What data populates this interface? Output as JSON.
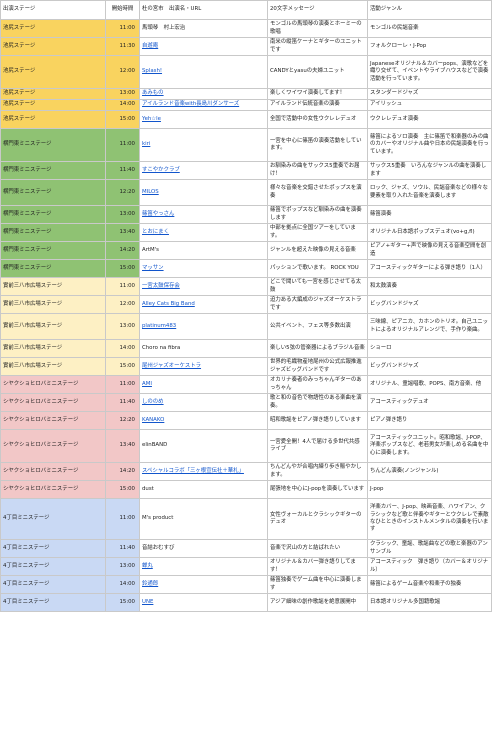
{
  "header": {
    "stage": "出演ステージ",
    "time": "開始時間",
    "name": "杜の宮市　出演名・URL",
    "msg": "20文字メッセージ",
    "genre": "活動ジャンル"
  },
  "stage_colors": {
    "yellow": "#f9d35f",
    "green": "#8fc273",
    "cream": "#fdf0c4",
    "pink": "#f2c7c7",
    "blue": "#c9d9f4"
  },
  "rows": [
    {
      "stage": "池尻ステージ",
      "color": "yellow",
      "time": "11:00",
      "name": "馬頭琴　村上宏治",
      "link": false,
      "msg": "モンゴルの馬頭琴の演奏とホーミーの歌唱",
      "genre": "モンゴルの民謡音楽",
      "h": 18
    },
    {
      "stage": "池尻ステージ",
      "color": "yellow",
      "time": "11:30",
      "name": "自遊庵",
      "link": true,
      "msg": "南米の縦笛ケーナとギターのユニットです",
      "genre": "フォルクローレ・J-Pop",
      "h": 18
    },
    {
      "stage": "池尻ステージ",
      "color": "yellow",
      "time": "12:00",
      "name": "Splash!",
      "link": true,
      "msg": "CANDYとyasuの夫婦ユニット",
      "genre": "Japaneseオリジナル＆カバーpops、演歌などを織り交ぜて、イベントやライブハウスなどで演奏活動を行っています。",
      "h": 33
    },
    {
      "stage": "池尻ステージ",
      "color": "yellow",
      "time": "13:00",
      "name": "あみもの",
      "link": true,
      "msg": "楽しくワイワイ演奏してます！",
      "genre": "スタンダードジャズ",
      "h": 11
    },
    {
      "stage": "池尻ステージ",
      "color": "yellow",
      "time": "14:00",
      "name": "アイルランド音楽with長島川ダンサーズ",
      "link": true,
      "msg": "アイルランド伝統音楽の演奏",
      "genre": "アイリッシュ",
      "h": 11
    },
    {
      "stage": "池尻ステージ",
      "color": "yellow",
      "time": "15:00",
      "name": "Yeh☆le",
      "link": true,
      "msg": "全国で活動中の女性ウクレレデュオ",
      "genre": "ウクレレデュオ演奏",
      "h": 18
    },
    {
      "stage": "横門東ミニステージ",
      "color": "green",
      "time": "11:00",
      "name": "kiri",
      "link": true,
      "msg": "一宮を中心に篠笛の演奏活動をしています。",
      "genre": "篠笛によるソロ演奏　主に篠笛で和楽器のみの曲のカバーやオリジナル曲や日本の民謡演奏を行っています。",
      "h": 33
    },
    {
      "stage": "横門東ミニステージ",
      "color": "green",
      "time": "11:40",
      "name": "すこやかクラブ",
      "link": true,
      "msg": "お馴染みの曲をサックス5重奏でお届け！",
      "genre": "サックス5重奏　いろんなジャンルの曲を演奏します",
      "h": 18
    },
    {
      "stage": "横門東ミニステージ",
      "color": "green",
      "time": "12:20",
      "name": "MILOS",
      "link": true,
      "msg": "様々な音楽を交錯させたポップスを演奏",
      "genre": "ロック、ジャズ、ソウル、民謡音楽などの様々な要素を取り入れた音楽を演奏します",
      "h": 26
    },
    {
      "stage": "横門東ミニステージ",
      "color": "green",
      "time": "13:00",
      "name": "篠笛やっさん",
      "link": true,
      "msg": "篠笛でポップスなど馴染みの曲を演奏します",
      "genre": "篠笛演奏",
      "h": 18
    },
    {
      "stage": "横門東ミニステージ",
      "color": "green",
      "time": "13:40",
      "name": "とおにまく",
      "link": true,
      "msg": "中部を拠点に全国ツアーをしています。",
      "genre": "オリジナル日本語ポップスデュオ(vo+g,fl)",
      "h": 18
    },
    {
      "stage": "横門東ミニステージ",
      "color": "green",
      "time": "14:20",
      "name": "ArtM's",
      "link": false,
      "msg": "ジャンルを超えた映像の見える音楽",
      "genre": "ピアノ+ギター+声で映像の見える音楽空間を創造",
      "h": 18
    },
    {
      "stage": "横門東ミニステージ",
      "color": "green",
      "time": "15:00",
      "name": "マッサン",
      "link": true,
      "msg": "パッションで歌います。 ROCK YOU",
      "genre": "アコースティックギターによる弾き語り（1人）",
      "h": 18
    },
    {
      "stage": "實前三八市広場ステージ",
      "color": "cream",
      "time": "11:00",
      "name": "一宮太鼓保存会",
      "link": true,
      "msg": "どこで聞いても一宮を感じさせてる太鼓",
      "genre": "和太鼓演奏",
      "h": 18
    },
    {
      "stage": "實前三八市広場ステージ",
      "color": "cream",
      "time": "12:00",
      "name": "Alley Cats Big Band",
      "link": true,
      "msg": "迫力ある大編成のジャズオーケストラです",
      "genre": "ビッグバンドジャズ",
      "h": 18
    },
    {
      "stage": "實前三八市広場ステージ",
      "color": "cream",
      "time": "13:00",
      "name": "platinum483",
      "link": true,
      "msg": "公共イベント、フェス等多数出演",
      "genre": "三味線、ピアニカ、カホンのトリオ。自己ユニットによるオリジナルアレンジで、手作り楽曲。",
      "h": 26
    },
    {
      "stage": "實前三八市広場ステージ",
      "color": "cream",
      "time": "14:00",
      "name": "Choro na fibra",
      "link": false,
      "msg": "楽しい5弦の管楽器によるブラジル音楽",
      "genre": "ショーロ",
      "h": 18
    },
    {
      "stage": "實前三八市広場ステージ",
      "color": "cream",
      "time": "15:00",
      "name": "尾州ジャズオーケストラ",
      "link": true,
      "msg": "世界的毛織物産地尾州の公式広報推進ジャズビッグバンドです",
      "genre": "ビッグバンドジャズ",
      "h": 18
    },
    {
      "stage": "シヤクショヒロバミニステージ",
      "color": "pink",
      "time": "11:00",
      "name": "AMI",
      "link": true,
      "msg": "オカリナ奏者のみっちゃんギターのあっちゃん",
      "genre": "オリジナル、童謡唱歌、POPS、南方音楽、他",
      "h": 18
    },
    {
      "stage": "シヤクショヒロバミニステージ",
      "color": "pink",
      "time": "11:40",
      "name": "しののめ",
      "link": true,
      "msg": "歌と和の音色で物語性のある楽曲を演奏。",
      "genre": "アコースティックデュオ",
      "h": 18
    },
    {
      "stage": "シヤクショヒロバミニステージ",
      "color": "pink",
      "time": "12:20",
      "name": "KANAKO",
      "link": true,
      "msg": "昭和歌謡をピアノ弾き語りしています",
      "genre": "ピアノ弾き語り",
      "h": 18
    },
    {
      "stage": "シヤクショヒロバミニステージ",
      "color": "pink",
      "time": "13:40",
      "name": "elinBAND",
      "link": false,
      "msg": "一宮愛全開！4人で届ける多世代共感ライブ",
      "genre": "アコースティックユニット。昭和歌謡、J-POP、洋楽ポップスなど、老若男女が楽しめる名曲を中心に演奏します。",
      "h": 33
    },
    {
      "stage": "シヤクショヒロバミニステージ",
      "color": "pink",
      "time": "14:20",
      "name": "スペシャルコラボ「三ヶ根宣伝社＋華札」",
      "link": true,
      "msg": "ちんどんやが合唱内練り歩き賑やかします。",
      "genre": "ちんどん演奏(ノンジャンル)",
      "h": 18
    },
    {
      "stage": "シヤクショヒロバミニステージ",
      "color": "pink",
      "time": "15:00",
      "name": "dust",
      "link": false,
      "msg": "尾張地を中心にJ-popを演奏しています",
      "genre": "J-pop",
      "h": 18
    },
    {
      "stage": "4丁目ミニステージ",
      "color": "blue",
      "time": "11:00",
      "name": "M's product",
      "link": false,
      "msg": "女性ヴォーカルとクラシックギターのデュオ",
      "genre": "洋楽カバー、J-pop、映画音楽、ハワイアン、クラシックなど歌と伴奏やギターとウクレレで素敵なひとときのインストルメンタルの演奏を行います",
      "h": 41
    },
    {
      "stage": "4丁目ミニステージ",
      "color": "blue",
      "time": "11:40",
      "name": "音結おむすび",
      "link": false,
      "msg": "音楽で沢山の方と結ばれたい",
      "genre": "クラシック、童謡、歌謡曲などの歌と楽器のアンサンブル",
      "h": 18
    },
    {
      "stage": "4丁目ミニステージ",
      "color": "blue",
      "time": "13:00",
      "name": "蝉丸",
      "link": true,
      "msg": "オリジナル＆カバー弾き語りしてます！",
      "genre": "アコースティック　弾き語り（カバー＆オリジナル）",
      "h": 18
    },
    {
      "stage": "4丁目ミニステージ",
      "color": "blue",
      "time": "14:00",
      "name": "鈴通郎",
      "link": true,
      "msg": "篠笛独奏でゲーム曲を中心に演奏します",
      "genre": "篠笛によるゲーム音楽や和楽子の独奏",
      "h": 18
    },
    {
      "stage": "4丁目ミニステージ",
      "color": "blue",
      "time": "15:00",
      "name": "UNE",
      "link": true,
      "msg": "アジア細味の創作歌謡を絶意展開中",
      "genre": "日本語オリジナル多国籍歌謡",
      "h": 18
    }
  ]
}
